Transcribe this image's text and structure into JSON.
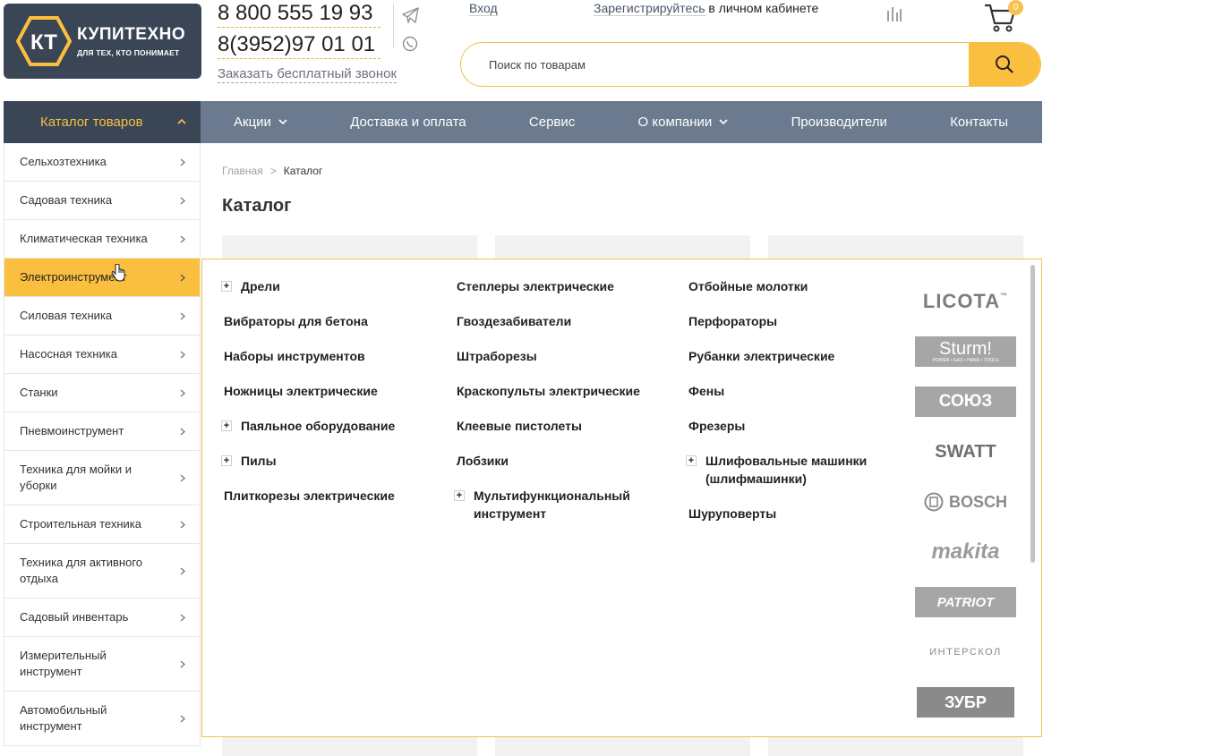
{
  "header": {
    "logo": {
      "badge": "КТ",
      "name": "КУПИТЕХНО",
      "slogan": "ДЛЯ ТЕХ, КТО ПОНИМАЕТ"
    },
    "phone1": "8 800 555 19 93",
    "phone2": "8(3952)97 01 01",
    "callback_label": "Заказать бесплатный звонок",
    "login_label": "Вход",
    "register_label": "Зарегистрируйтесь",
    "register_suffix": " в личном кабинете",
    "cart_count": "0",
    "search_placeholder": "Поиск по товарам"
  },
  "nav": {
    "catalog_label": "Каталог товаров",
    "items": [
      {
        "label": "Акции"
      },
      {
        "label": "Доставка и оплата"
      },
      {
        "label": "Сервис"
      },
      {
        "label": "О компании"
      },
      {
        "label": "Производители"
      },
      {
        "label": "Контакты"
      }
    ]
  },
  "sidebar": {
    "items": [
      {
        "label": "Сельхозтехника"
      },
      {
        "label": "Садовая техника"
      },
      {
        "label": "Климатическая техника"
      },
      {
        "label": "Электроинструмент"
      },
      {
        "label": "Силовая техника"
      },
      {
        "label": "Насосная техника"
      },
      {
        "label": "Станки"
      },
      {
        "label": "Пневмоинструмент"
      },
      {
        "label": "Техника для мойки и уборки"
      },
      {
        "label": "Строительная техника"
      },
      {
        "label": "Техника для активного отдыха"
      },
      {
        "label": "Садовый инвентарь"
      },
      {
        "label": "Измерительный инструмент"
      },
      {
        "label": "Автомобильный инструмент"
      }
    ]
  },
  "breadcrumb": {
    "home": "Главная",
    "separator": ">",
    "current": "Каталог"
  },
  "page_title": "Каталог",
  "dropdown": {
    "col1": [
      {
        "label": "Дрели",
        "plus": "+"
      },
      {
        "label": "Вибраторы для бетона"
      },
      {
        "label": "Наборы инструментов"
      },
      {
        "label": "Ножницы электрические"
      },
      {
        "label": "Паяльное оборудование",
        "plus": "+"
      },
      {
        "label": "Пилы",
        "plus": "+"
      },
      {
        "label": "Плиткорезы электрические"
      }
    ],
    "col2": [
      {
        "label": "Степлеры электрические"
      },
      {
        "label": "Гвоздезабиватели"
      },
      {
        "label": "Штраборезы"
      },
      {
        "label": "Краскопульты электрические"
      },
      {
        "label": "Клеевые пистолеты"
      },
      {
        "label": "Лобзики"
      },
      {
        "label": "Мультифункциональный инструмент",
        "plus": "+"
      }
    ],
    "col3": [
      {
        "label": "Отбойные молотки"
      },
      {
        "label": "Перфораторы"
      },
      {
        "label": "Рубанки электрические"
      },
      {
        "label": "Фены"
      },
      {
        "label": "Фрезеры"
      },
      {
        "label": "Шлифовальные машинки (шлифмашинки)",
        "plus": "+"
      },
      {
        "label": "Шуруповерты"
      }
    ],
    "brands": [
      {
        "label": "LICOTA",
        "mark": "™"
      },
      {
        "label": "Sturm!",
        "sub": "POWER • GAS • HAND • TOOLS"
      },
      {
        "label": "СОЮЗ"
      },
      {
        "label": "SWATT"
      },
      {
        "label": "BOSCH"
      },
      {
        "label": "makita"
      },
      {
        "label": "PATRIOT"
      },
      {
        "label": "ИНТЕРСКОЛ"
      },
      {
        "label": "ЗУБР"
      }
    ]
  },
  "colors": {
    "accent": "#fbbf40",
    "dark": "#3a4656",
    "nav": "#6c7a8f"
  }
}
